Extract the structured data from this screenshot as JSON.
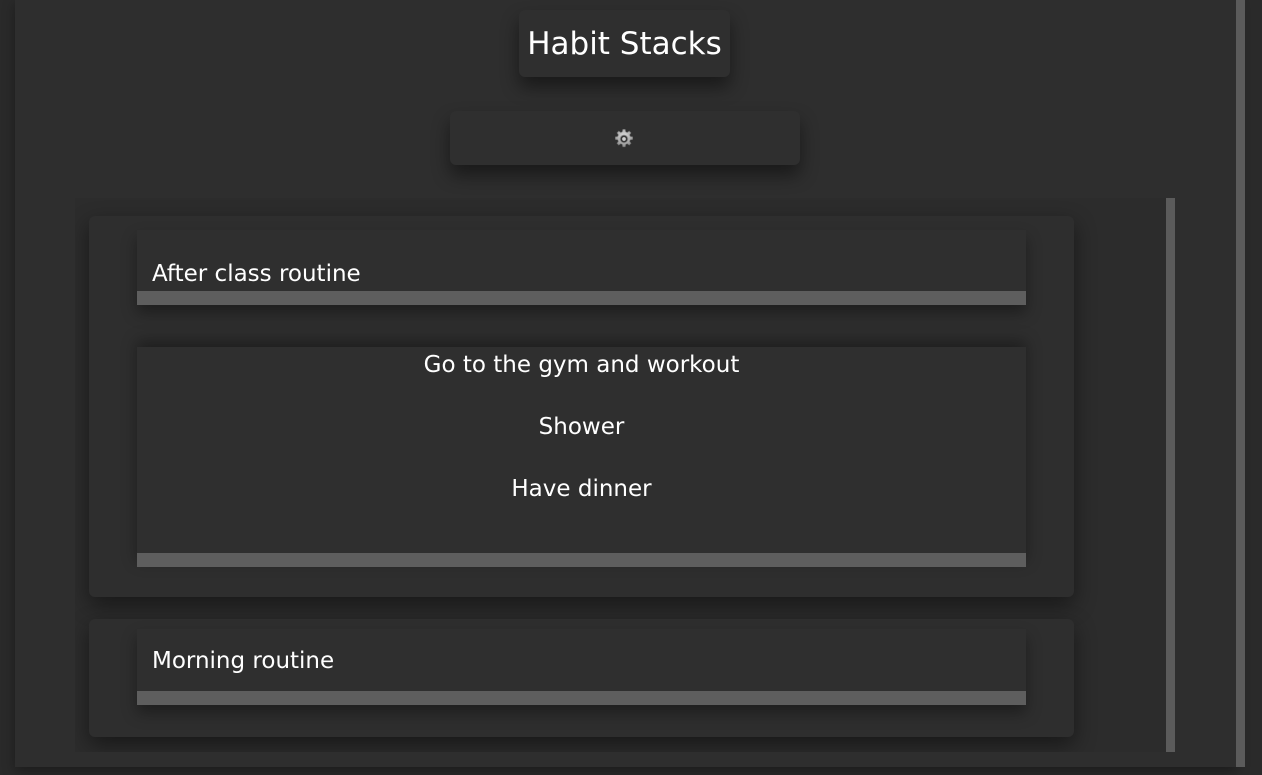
{
  "app": {
    "title": "Habit Stacks"
  },
  "settings": {
    "icon": "gear-icon"
  },
  "stacks": [
    {
      "name": "After class routine",
      "expanded": true,
      "habits": [
        "Go to the gym and workout",
        "Shower",
        "Have dinner"
      ]
    },
    {
      "name": "Morning routine",
      "expanded": false,
      "habits": []
    }
  ],
  "colors": {
    "background": "#2a2a2a",
    "surface": "#2e2e2e",
    "bar": "#5e5e5e",
    "text": "#ffffff"
  }
}
